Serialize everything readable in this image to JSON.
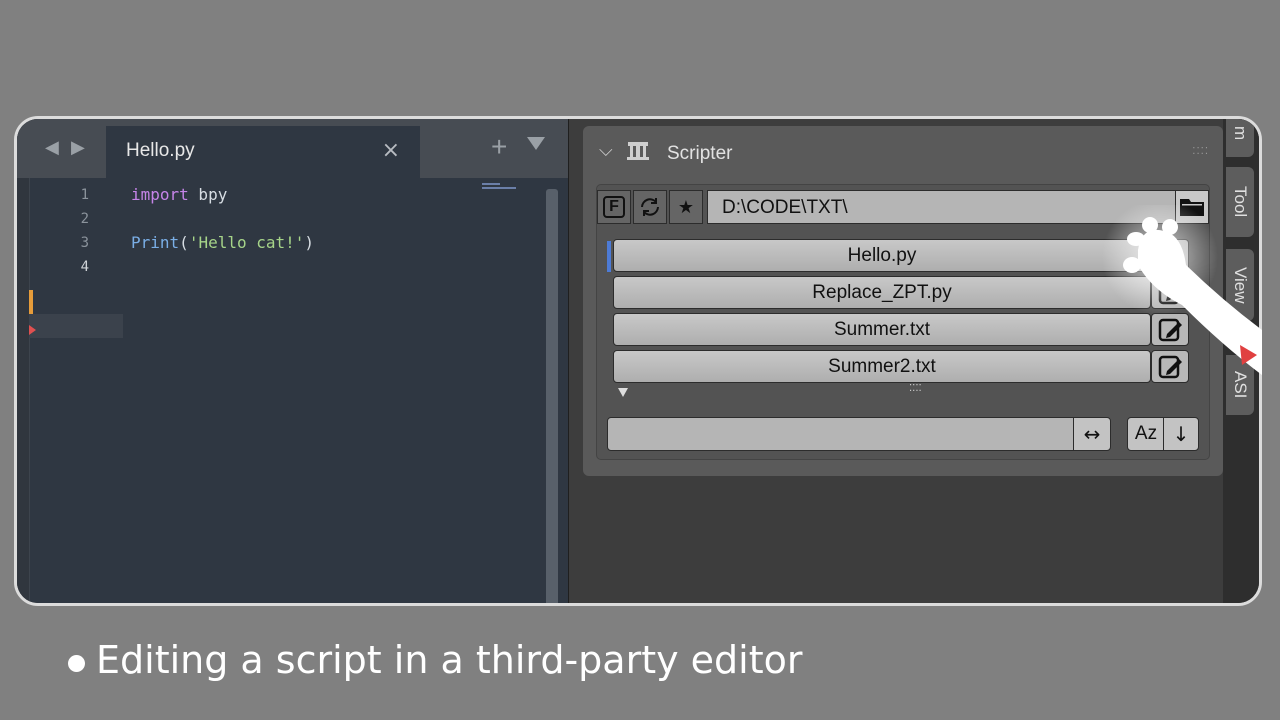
{
  "editor": {
    "tab_title": "Hello.py",
    "tab_close": "×",
    "tab_add": "+",
    "lines": [
      {
        "number": "1",
        "tokens": [
          {
            "t": "import",
            "c": "kw"
          },
          {
            "t": " bpy",
            "c": ""
          }
        ]
      },
      {
        "number": "2",
        "tokens": []
      },
      {
        "number": "3",
        "tokens": [
          {
            "t": "Print",
            "c": "fn"
          },
          {
            "t": "(",
            "c": ""
          },
          {
            "t": "'Hello cat!'",
            "c": "str"
          },
          {
            "t": ")",
            "c": ""
          }
        ]
      },
      {
        "number": "4",
        "tokens": []
      }
    ]
  },
  "scripter": {
    "title": "Scripter",
    "collapse_icon": "chevron-down-icon",
    "toolbar": {
      "f_label": "F",
      "reload_icon": "reload-icon",
      "favorite_icon": "star-icon",
      "path": "D:\\CODE\\TXT\\",
      "folder_icon": "folder-icon"
    },
    "files": [
      {
        "name": "Hello.py",
        "active": true
      },
      {
        "name": "Replace_ZPT.py",
        "active": false
      },
      {
        "name": "Summer.txt",
        "active": false
      },
      {
        "name": "Summer2.txt",
        "active": false
      }
    ],
    "filter_value": "",
    "swap_label": "↔",
    "sort_az_label": "Az",
    "sort_dir_label": "↓"
  },
  "sidebar_tabs": [
    "m",
    "Tool",
    "View",
    "ASI"
  ],
  "caption": "Editing a script in a third-party editor",
  "colors": {
    "background": "#808080",
    "editor_bg": "#2f3742",
    "keyword": "#c584e8",
    "function": "#7aaee6",
    "string": "#a6d489"
  }
}
